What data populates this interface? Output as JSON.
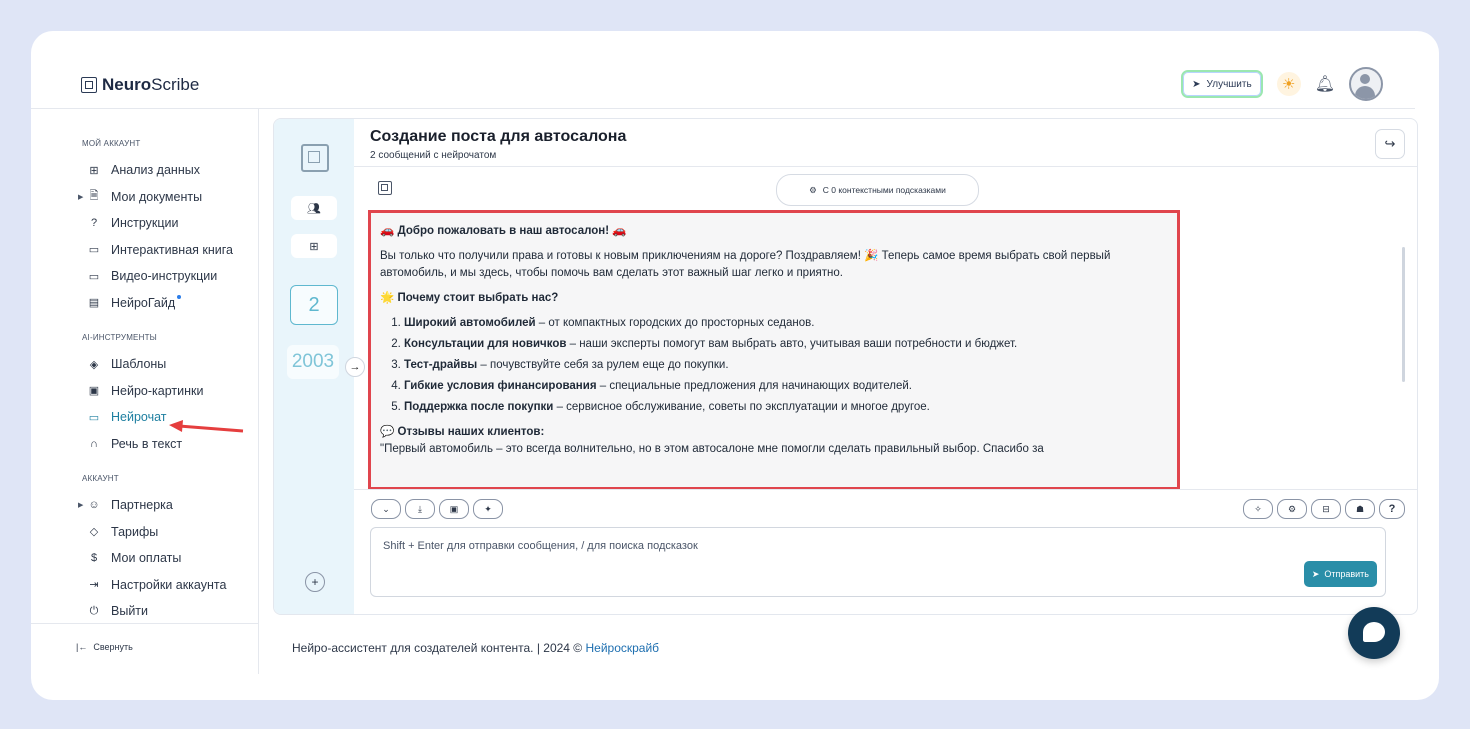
{
  "brand": {
    "bold": "Neuro",
    "light": "Scribe"
  },
  "header": {
    "upgrade_label": "Улучшить"
  },
  "sidebar": {
    "sections": [
      {
        "title": "МОЙ АККАУНТ",
        "items": [
          {
            "label": "Анализ данных",
            "icon": "grid-icon"
          },
          {
            "label": "Мои документы",
            "icon": "document-icon",
            "caret": true
          },
          {
            "label": "Инструкции",
            "icon": "help-icon"
          },
          {
            "label": "Интерактивная книга",
            "icon": "book-icon"
          },
          {
            "label": "Видео-инструкции",
            "icon": "video-icon"
          },
          {
            "label": "НейроГайд",
            "icon": "guide-icon",
            "dot": true
          }
        ]
      },
      {
        "title": "AI-ИНСТРУМЕНТЫ",
        "items": [
          {
            "label": "Шаблоны",
            "icon": "layers-icon"
          },
          {
            "label": "Нейро-картинки",
            "icon": "image-icon"
          },
          {
            "label": "Нейрочат",
            "icon": "chat-icon",
            "active": true
          },
          {
            "label": "Речь в текст",
            "icon": "headphones-icon"
          }
        ]
      },
      {
        "title": "АККАУНТ",
        "items": [
          {
            "label": "Партнерка",
            "icon": "users-icon",
            "caret": true
          },
          {
            "label": "Тарифы",
            "icon": "tag-icon"
          },
          {
            "label": "Мои оплаты",
            "icon": "dollar-icon"
          },
          {
            "label": "Настройки аккаунта",
            "icon": "login-icon"
          },
          {
            "label": "Выйти",
            "icon": "power-icon"
          }
        ]
      }
    ],
    "collapse_label": "Свернуть"
  },
  "chat": {
    "title": "Создание поста для автосалона",
    "subtitle": "2 сообщений с нейрочатом",
    "count": "2",
    "year": "2003",
    "context_pill": "С 0 контекстными подсказками",
    "message": {
      "welcome": "🚗 Добро пожаловать в наш автосалон! 🚗",
      "intro": "Вы только что получили права и готовы к новым приключениям на дороге? Поздравляем! 🎉 Теперь самое время выбрать свой первый автомобиль, и мы здесь, чтобы помочь вам сделать этот важный шаг легко и приятно.",
      "why_heading": "🌟 Почему стоит выбрать нас?",
      "list": [
        {
          "bold": "Широкий автомобилей",
          "rest": " – от компактных городских до просторных седанов."
        },
        {
          "bold": "Консультации для новичков",
          "rest": " – наши эксперты помогут вам выбрать авто, учитывая ваши потребности и бюджет."
        },
        {
          "bold": "Тест-драйвы",
          "rest": " – почувствуйте себя за рулем еще до покупки."
        },
        {
          "bold": "Гибкие условия финансирования",
          "rest": " – специальные предложения для начинающих водителей."
        },
        {
          "bold": "Поддержка после покупки",
          "rest": " – сервисное обслуживание, советы по эксплуатации и многое другое."
        }
      ],
      "reviews_heading": "💬 Отзывы наших клиентов:",
      "review": "\"Первый автомобиль – это всегда волнительно, но в этом автосалоне мне помогли сделать правильный выбор. Спасибо за"
    },
    "input_placeholder": "Shift + Enter для отправки сообщения, / для поиска подсказок",
    "send_label": "Отправить"
  },
  "footer": {
    "text": "Нейро-ассистент для создателей контента.  | 2024 © ",
    "link": "Нейроскрайб"
  }
}
